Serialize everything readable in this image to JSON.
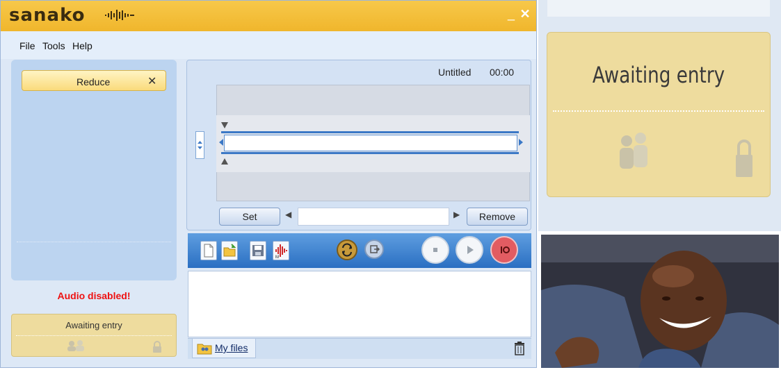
{
  "app": {
    "logo_text": "sanako",
    "window_controls": {
      "minimize": "_",
      "close": "✕"
    }
  },
  "menu": {
    "items": [
      "File",
      "Tools",
      "Help"
    ]
  },
  "left_panel": {
    "reduce_button": {
      "label": "Reduce",
      "close_glyph": "✕"
    },
    "status_text": "Audio disabled!",
    "status_color": "#ee1111"
  },
  "awaiting_entry_small": {
    "label": "Awaiting entry",
    "icons": [
      "users-icon",
      "lock-icon"
    ]
  },
  "recorder": {
    "title": "Untitled",
    "time": "00:00",
    "set_label": "Set",
    "remove_label": "Remove",
    "prev_glyph": "◀",
    "next_glyph": "▶",
    "mark_value": ""
  },
  "toolbar": {
    "file_tools": [
      "new-file-icon",
      "open-folder-icon",
      "save-icon",
      "media-wave-icon"
    ],
    "mode_buttons": [
      "loop-icon",
      "exit-icon"
    ],
    "transport": [
      "stop-icon",
      "play-icon",
      "record-icon"
    ]
  },
  "files": {
    "tab_label": "My files",
    "icons": [
      "folder-users-icon",
      "trash-icon"
    ]
  },
  "awaiting_entry_large": {
    "label": "Awaiting entry"
  },
  "colors": {
    "title_bar": "#f0b62c",
    "panel_blue": "#bcd4f0",
    "awaiting_yellow": "#eedc9e",
    "toolbar_blue": "#2a6fc2",
    "record_red": "#e25c62"
  }
}
